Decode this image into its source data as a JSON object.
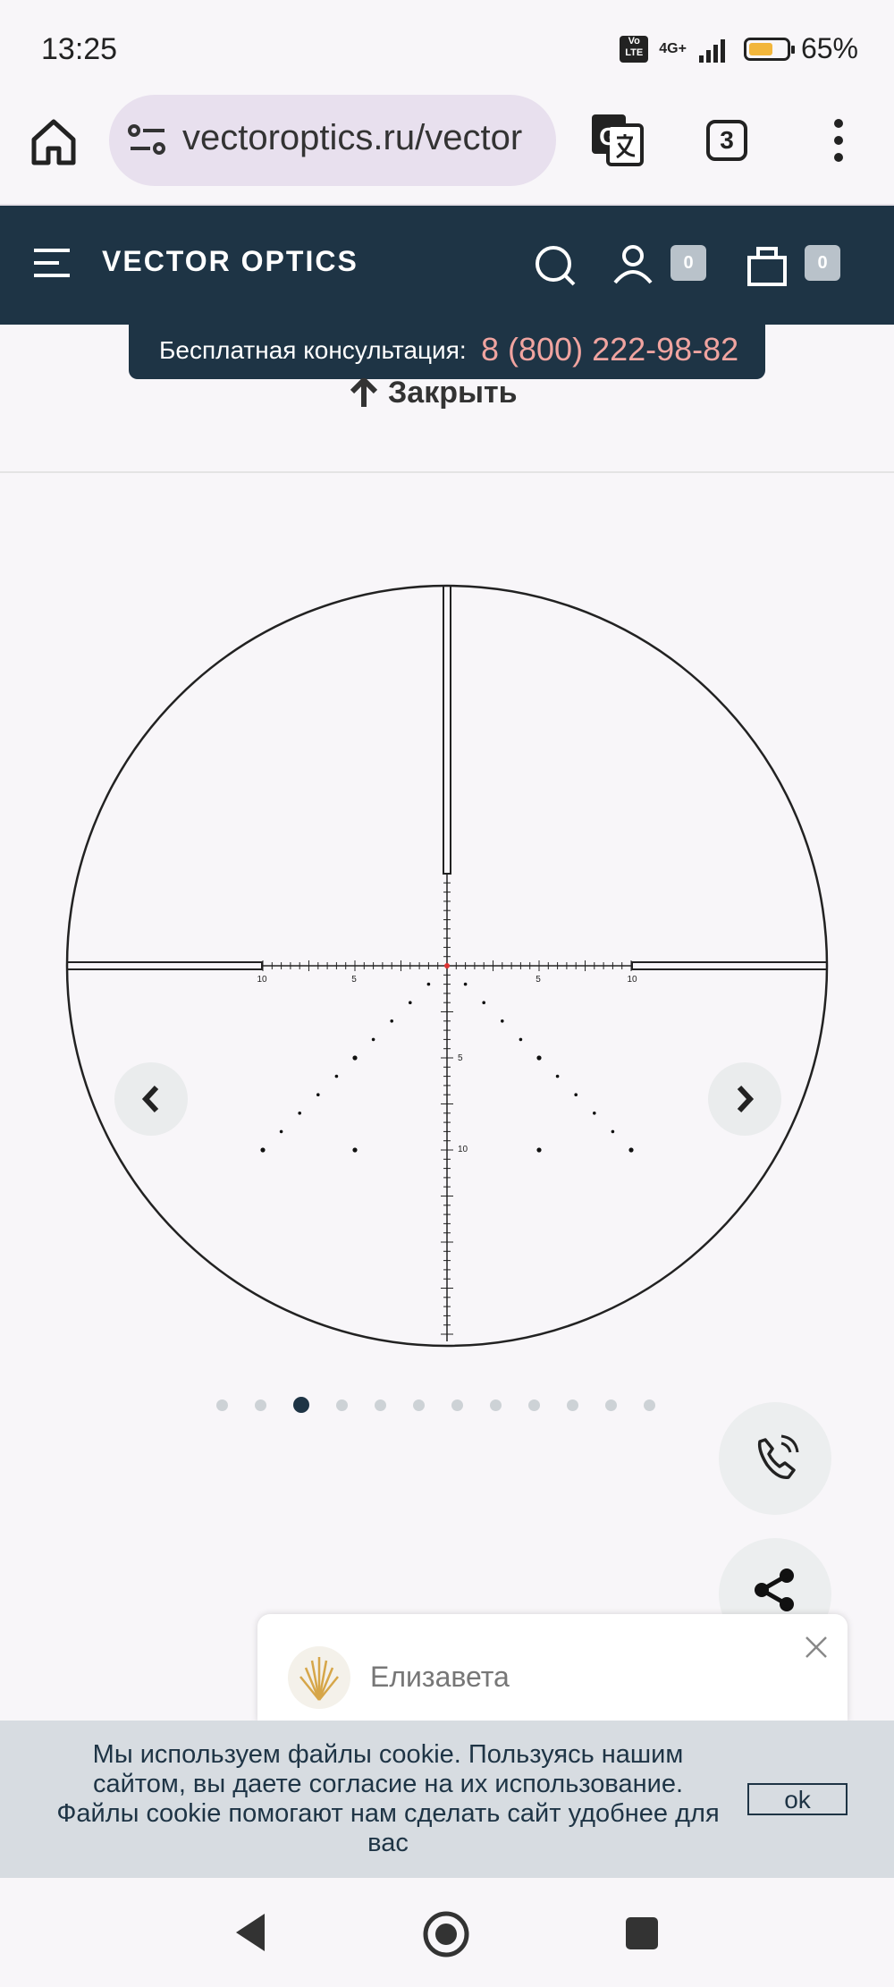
{
  "status_bar": {
    "time": "13:25",
    "volte": "Vo LTE",
    "network": "4G+",
    "battery_level": 0.65,
    "battery_percent": "65%"
  },
  "browser": {
    "url": "vectoroptics.ru/vector",
    "tab_count": "3"
  },
  "site_header": {
    "logo": "VECTOR OPTICS",
    "account_count": "0",
    "cart_count": "0",
    "colors": {
      "header_bg": "#1e3445",
      "phone_accent": "#f0a4a0"
    }
  },
  "consult": {
    "label": "Бесплатная консультация:",
    "phone": "8 (800) 222-98-82"
  },
  "close_link": "Закрыть",
  "reticle_labels": {
    "left_10": "10",
    "left_5": "5",
    "right_5": "5",
    "right_10": "10",
    "down_5": "5",
    "down_10": "10"
  },
  "gallery": {
    "dot_count": 12,
    "active_index": 2
  },
  "chat": {
    "agent_name": "Елизавета"
  },
  "cookie": {
    "text": "Мы используем файлы cookie. Пользуясь нашим сайтом, вы даете согласие на их использование. Файлы cookie помогают нам сделать сайт удобнее для вас",
    "ok_label": "ok"
  }
}
